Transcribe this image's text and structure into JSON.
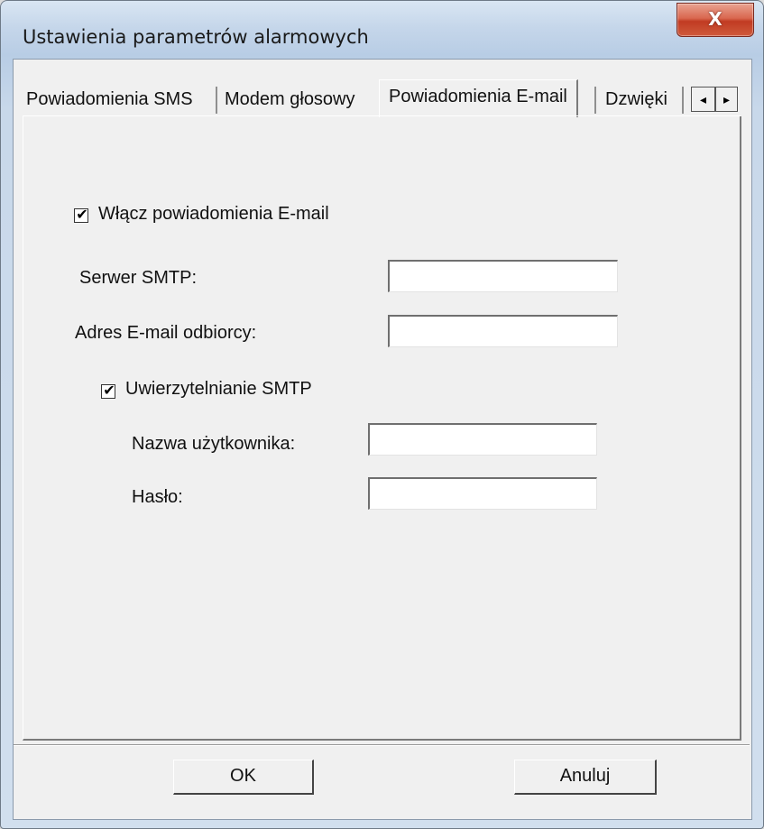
{
  "window": {
    "title": "Ustawienia parametrów alarmowych",
    "close_glyph": "X"
  },
  "tabs": [
    {
      "label": "Powiadomienia SMS",
      "active": false
    },
    {
      "label": "Modem głosowy",
      "active": false
    },
    {
      "label": "Powiadomienia E-mail",
      "active": true
    },
    {
      "label": "Dzwięki",
      "active": false
    }
  ],
  "tab_scroll": {
    "left": "◂",
    "right": "▸"
  },
  "email_settings": {
    "enable_checkbox": {
      "label": "Włącz powiadomienia E-mail",
      "checked": true
    },
    "smtp_server": {
      "label": "Serwer SMTP:",
      "value": ""
    },
    "recipient_email": {
      "label": "Adres E-mail odbiorcy:",
      "value": ""
    },
    "smtp_auth_checkbox": {
      "label": "Uwierzytelnianie SMTP",
      "checked": true
    },
    "username": {
      "label": "Nazwa użytkownika:",
      "value": ""
    },
    "password": {
      "label": "Hasło:",
      "value": ""
    }
  },
  "buttons": {
    "ok": "OK",
    "cancel": "Anuluj"
  },
  "check_glyph": "✔"
}
